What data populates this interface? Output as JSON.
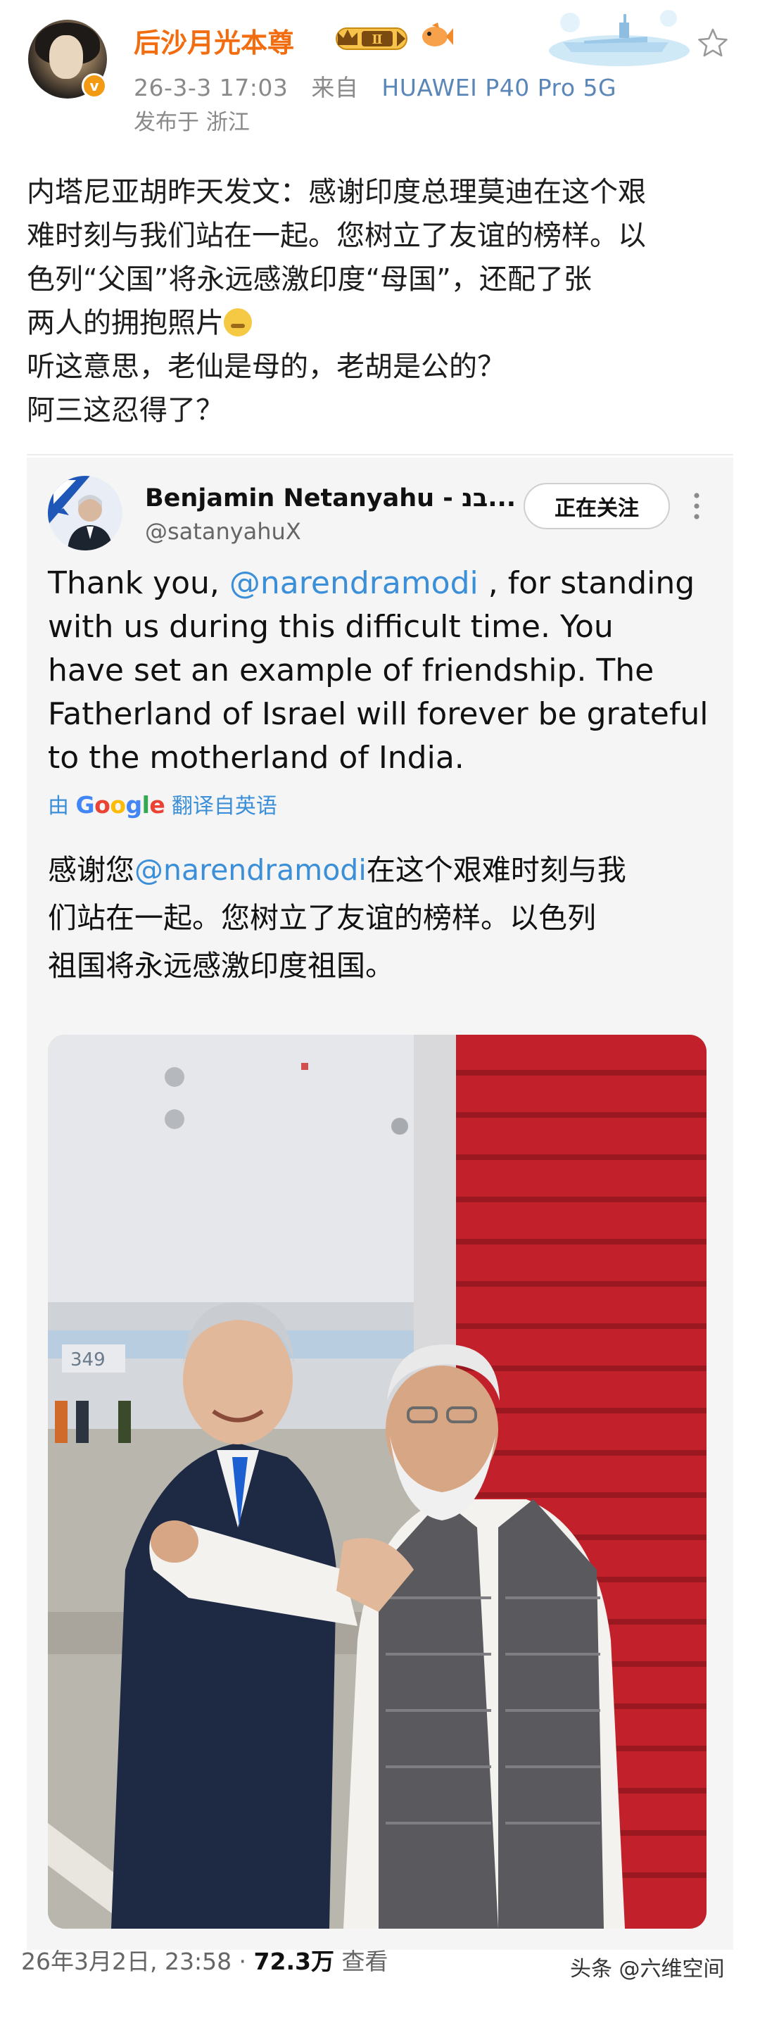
{
  "post": {
    "author": "后沙月光本尊",
    "level_badge": "Ⅱ",
    "verified_mark": "v",
    "timestamp": "26-3-3 17:03",
    "source_prefix": "来自",
    "device": "HUAWEI P40 Pro 5G",
    "location": "发布于 浙江",
    "body_lines": [
      "内塔尼亚胡昨天发文：感谢印度总理莫迪在这个艰",
      "难时刻与我们站在一起。您树立了友谊的榜样。以",
      "色列“父国”将永远感激印度“母国”，还配了张",
      "两人的拥抱照片",
      "听这意思，老仙是母的，老胡是公的？",
      "阿三这忍得了？"
    ]
  },
  "tweet": {
    "display_name": "Benjamin Netanyahu - בנ...",
    "handle": "@satanyahuX",
    "follow_button": "正在关注",
    "text_lines": [
      {
        "before": "Thank you, ",
        "mention": "@narendramodi",
        "after": " , for standing"
      },
      {
        "before": "with us during this difficult time. You",
        "mention": "",
        "after": ""
      },
      {
        "before": "have set an example of friendship. The",
        "mention": "",
        "after": ""
      },
      {
        "before": "Fatherland of Israel will forever be grateful",
        "mention": "",
        "after": ""
      },
      {
        "before": "to the motherland of India.",
        "mention": "",
        "after": ""
      }
    ],
    "translation_prefix": "由",
    "translation_engine": "Google",
    "translation_suffix": "翻译自英语",
    "translated_lines": [
      {
        "before": "感谢您",
        "mention": "@narendramodi",
        "after": "在这个艰难时刻与我"
      },
      {
        "before": "们站在一起。您树立了友谊的榜样。以色列",
        "mention": "",
        "after": ""
      },
      {
        "before": "祖国将永远感激印度祖国。",
        "mention": "",
        "after": ""
      }
    ],
    "photo_marks": {
      "plane_number": "349"
    },
    "footer_date": "26年3月2日, 23:58 · ",
    "footer_views": "72.3万",
    "footer_views_label": " 查看"
  },
  "watermark": "头条 @六维空间",
  "colors": {
    "author_orange": "#f26c10",
    "link_blue": "#3a8fd8",
    "device_blue": "#5a86b8",
    "card_bg": "#f5f5f5"
  },
  "icons": [
    "crown-badge-icon",
    "fish-icon",
    "star-icon",
    "more-vertical-icon",
    "verified-icon"
  ]
}
